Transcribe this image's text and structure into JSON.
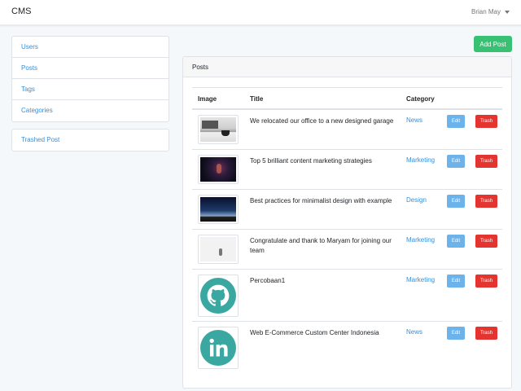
{
  "navbar": {
    "brand": "CMS",
    "user": "Brian May"
  },
  "sidebar": {
    "items": [
      {
        "label": "Users"
      },
      {
        "label": "Posts"
      },
      {
        "label": "Tags"
      },
      {
        "label": "Categories"
      }
    ],
    "extra": {
      "label": "Trashed Post"
    }
  },
  "toolbar": {
    "add_label": "Add Post"
  },
  "posts_card": {
    "title": "Posts",
    "columns": {
      "image": "Image",
      "title": "Title",
      "category": "Category"
    },
    "rows": [
      {
        "title": "We relocated our office to a new designed garage",
        "category": "News",
        "image": "office-photo",
        "edit": "Edit",
        "trash": "Trash"
      },
      {
        "title": "Top 5 brilliant content marketing strategies",
        "category": "Marketing",
        "image": "night-photo",
        "edit": "Edit",
        "trash": "Trash"
      },
      {
        "title": "Best practices for minimalist design with example",
        "category": "Design",
        "image": "city-photo",
        "edit": "Edit",
        "trash": "Trash"
      },
      {
        "title": "Congratulate and thank to Maryam for joining our team",
        "category": "Marketing",
        "image": "minimal-photo",
        "edit": "Edit",
        "trash": "Trash"
      },
      {
        "title": "Percobaan1",
        "category": "Marketing",
        "image": "github-logo",
        "edit": "Edit",
        "trash": "Trash"
      },
      {
        "title": "Web E-Commerce Custom Center Indonesia",
        "category": "News",
        "image": "linkedin-logo",
        "edit": "Edit",
        "trash": "Trash"
      }
    ]
  },
  "colors": {
    "primary": "#3490dc",
    "success": "#38c172",
    "danger": "#e3342f",
    "info": "#6cb2eb",
    "logo_teal": "#3aa8a0"
  }
}
